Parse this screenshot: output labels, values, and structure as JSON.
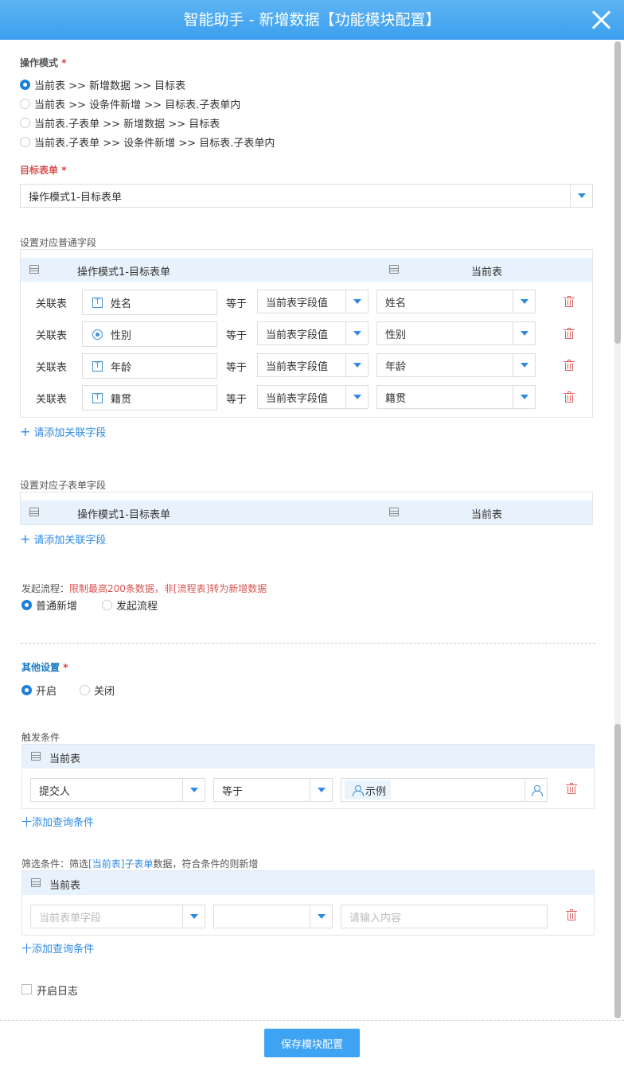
{
  "window": {
    "title": "智能助手 - 新增数据【功能模块配置】"
  },
  "operation_mode": {
    "label": "操作模式",
    "star": "*",
    "options": [
      "当前表 >> 新增数据 >> 目标表",
      "当前表 >> 设条件新增 >> 目标表.子表单内",
      "当前表.子表单 >> 新增数据 >> 目标表",
      "当前表.子表单 >> 设条件新增 >> 目标表.子表单内"
    ],
    "selected_index": 0
  },
  "target_form": {
    "label": "目标表单",
    "star": "*",
    "value": "操作模式1-目标表单"
  },
  "normal_fields": {
    "label": "设置对应普通字段",
    "head_left": "操作模式1-目标表单",
    "head_right": "当前表",
    "rows": [
      {
        "rel": "关联表",
        "field": "姓名",
        "field_icon": "text-field-icon",
        "op": "等于",
        "mode": "当前表字段值",
        "value": "姓名"
      },
      {
        "rel": "关联表",
        "field": "性别",
        "field_icon": "radio-field-icon",
        "op": "等于",
        "mode": "当前表字段值",
        "value": "性别"
      },
      {
        "rel": "关联表",
        "field": "年龄",
        "field_icon": "text-field-icon",
        "op": "等于",
        "mode": "当前表字段值",
        "value": "年龄"
      },
      {
        "rel": "关联表",
        "field": "籍贯",
        "field_icon": "text-field-icon",
        "op": "等于",
        "mode": "当前表字段值",
        "value": "籍贯"
      }
    ],
    "add_label": "请添加关联字段"
  },
  "sub_fields": {
    "label": "设置对应子表单字段",
    "head_left": "操作模式1-目标表单",
    "head_right": "当前表",
    "add_label": "请添加关联字段"
  },
  "flow": {
    "label": "发起流程：",
    "note": "限制最高200条数据，非[流程表]转为新增数据",
    "options": [
      "普通新增",
      "发起流程"
    ],
    "selected_index": 0
  },
  "other": {
    "label": "其他设置",
    "star": "*",
    "options": [
      "开启",
      "关闭"
    ],
    "selected_index": 0
  },
  "trigger": {
    "label": "触发条件",
    "head": "当前表",
    "field": "提交人",
    "op": "等于",
    "value": "示例",
    "add_label": "十添加查询条件"
  },
  "filter": {
    "label_prefix": "筛选条件：筛选",
    "label_link": "[当前表]子表单",
    "label_suffix": "数据，符合条件的则新增",
    "head": "当前表",
    "field_placeholder": "当前表单字段",
    "value_placeholder": "请输入内容",
    "add_label": "十添加查询条件"
  },
  "log": {
    "label": "开启日志",
    "checked": false
  },
  "footer": {
    "save_label": "保存模块配置"
  },
  "colors": {
    "accent": "#3fa3f3",
    "header": "#4aa8f0",
    "danger": "#e06060"
  }
}
